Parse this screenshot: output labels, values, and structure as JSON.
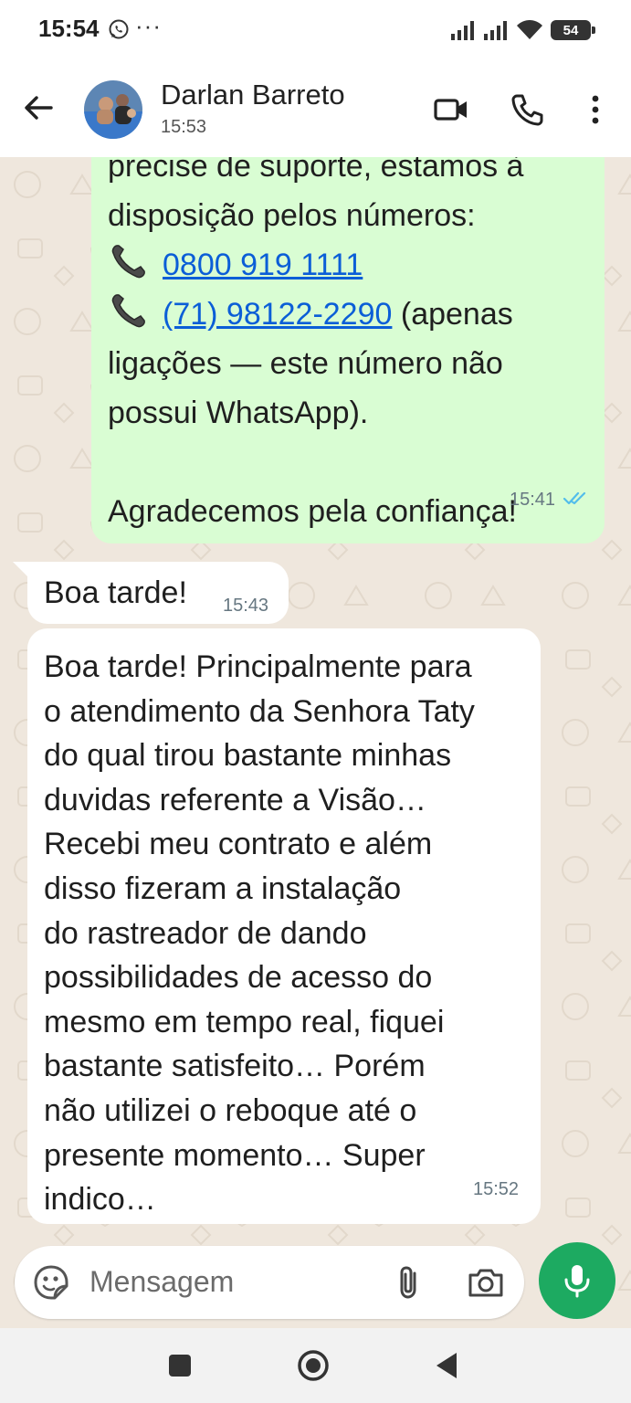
{
  "status_bar": {
    "time": "15:54",
    "notification_icons": [
      "whatsapp-icon"
    ],
    "more": "···",
    "battery": "54"
  },
  "header": {
    "contact_name": "Darlan Barreto",
    "last_seen": "15:53"
  },
  "messages": {
    "outgoing": {
      "lines": [
        "precise de suporte, estamos à",
        "disposição pelos números:"
      ],
      "phone1": "0800 919 1111",
      "phone2": "(71) 98122-2290",
      "phone2_suffix": " (apenas",
      "lines2": [
        "ligações — este número não",
        "possui WhatsApp)."
      ],
      "closing": "Agradecemos pela confiança!",
      "time": "15:41",
      "status": "read"
    },
    "incoming1": {
      "text": "Boa tarde!",
      "time": "15:43"
    },
    "incoming2": {
      "text": "Boa tarde! Principalmente para\no atendimento da Senhora Taty\ndo qual tirou bastante minhas\nduvidas referente a Visão…\nRecebi meu contrato e além\ndisso fizeram a instalação\ndo rastreador de dando\npossibilidades de acesso do\nmesmo em tempo real, fiquei\nbastante satisfeito… Porém\nnão utilizei o reboque até o\npresente momento… Super\nindico…",
      "time": "15:52"
    }
  },
  "input": {
    "placeholder": "Mensagem"
  },
  "colors": {
    "outgoing_bubble": "#d9fdd3",
    "incoming_bubble": "#ffffff",
    "mic_button": "#1daa61",
    "link": "#0b5ed7",
    "read_ticks": "#53bdeb"
  }
}
